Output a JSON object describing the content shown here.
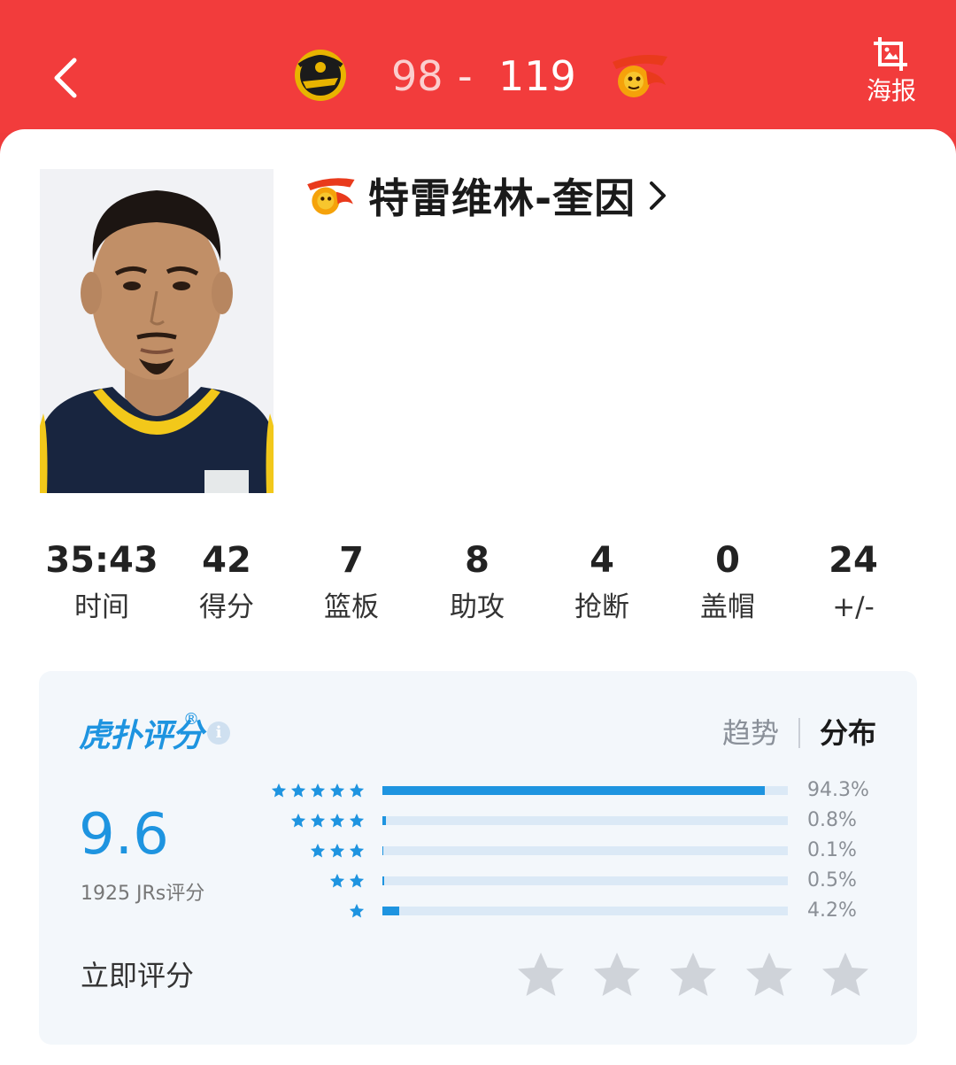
{
  "header": {
    "score_home": "98",
    "score_separator": "-",
    "score_away": "119",
    "poster_label": "海报"
  },
  "player": {
    "name": "特雷维林-奎因"
  },
  "stats": [
    {
      "value": "35:43",
      "label": "时间"
    },
    {
      "value": "42",
      "label": "得分"
    },
    {
      "value": "7",
      "label": "篮板"
    },
    {
      "value": "8",
      "label": "助攻"
    },
    {
      "value": "4",
      "label": "抢断"
    },
    {
      "value": "0",
      "label": "盖帽"
    },
    {
      "value": "24",
      "label": "+/-"
    }
  ],
  "rating": {
    "brand": "虎扑评分",
    "brand_mark": "®",
    "tabs": {
      "trend": "趋势",
      "distribution": "分布"
    },
    "score": "9.6",
    "vote_count": "1925 JRs评分",
    "rate_now_label": "立即评分",
    "distribution": [
      {
        "stars": 5,
        "percent": "94.3%",
        "fraction": 0.943
      },
      {
        "stars": 4,
        "percent": "0.8%",
        "fraction": 0.008
      },
      {
        "stars": 3,
        "percent": "0.1%",
        "fraction": 0.001
      },
      {
        "stars": 2,
        "percent": "0.5%",
        "fraction": 0.005
      },
      {
        "stars": 1,
        "percent": "4.2%",
        "fraction": 0.042
      }
    ]
  },
  "colors": {
    "header_red": "#f23c3c",
    "accent_blue": "#1e94e0",
    "bar_track": "#dbe9f6",
    "panel_bg": "#f3f7fb",
    "star_gray": "#cfd3d9"
  },
  "icons": {
    "back": "chevron-left-icon",
    "poster": "image-crop-icon",
    "info": "info-icon",
    "star": "star-icon"
  }
}
